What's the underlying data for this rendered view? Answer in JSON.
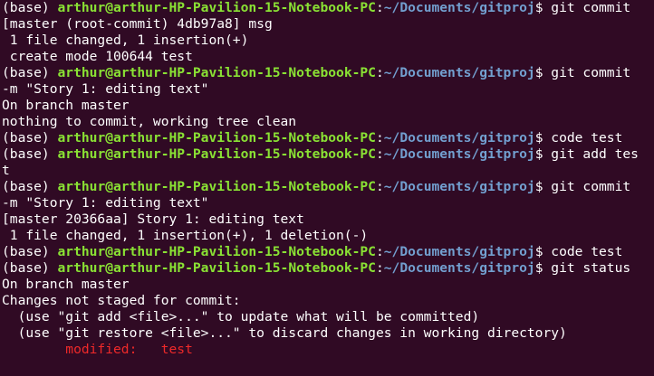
{
  "terminal": {
    "colors": {
      "background": "#300a24",
      "text": "#ffffff",
      "user_host": "#8ae234",
      "path": "#729fcf",
      "modified": "#ef2929"
    },
    "lines": [
      {
        "type": "prompt",
        "env": "(base) ",
        "user": "arthur@arthur-HP-Pavilion-15-Notebook-PC",
        "colon": ":",
        "path": "~/Documents/gitproj",
        "dollar": "$ ",
        "cmd": "git commit"
      },
      {
        "type": "text",
        "text": "[master (root-commit) 4db97a8] msg"
      },
      {
        "type": "text",
        "text": " 1 file changed, 1 insertion(+)"
      },
      {
        "type": "text",
        "text": " create mode 100644 test"
      },
      {
        "type": "prompt",
        "env": "(base) ",
        "user": "arthur@arthur-HP-Pavilion-15-Notebook-PC",
        "colon": ":",
        "path": "~/Documents/gitproj",
        "dollar": "$ ",
        "cmd": "git commit"
      },
      {
        "type": "text",
        "text": "-m \"Story 1: editing text\""
      },
      {
        "type": "text",
        "text": "On branch master"
      },
      {
        "type": "text",
        "text": "nothing to commit, working tree clean"
      },
      {
        "type": "prompt",
        "env": "(base) ",
        "user": "arthur@arthur-HP-Pavilion-15-Notebook-PC",
        "colon": ":",
        "path": "~/Documents/gitproj",
        "dollar": "$ ",
        "cmd": "code test"
      },
      {
        "type": "prompt",
        "env": "(base) ",
        "user": "arthur@arthur-HP-Pavilion-15-Notebook-PC",
        "colon": ":",
        "path": "~/Documents/gitproj",
        "dollar": "$ ",
        "cmd": "git add tes"
      },
      {
        "type": "text",
        "text": "t"
      },
      {
        "type": "prompt",
        "env": "(base) ",
        "user": "arthur@arthur-HP-Pavilion-15-Notebook-PC",
        "colon": ":",
        "path": "~/Documents/gitproj",
        "dollar": "$ ",
        "cmd": "git commit"
      },
      {
        "type": "text",
        "text": "-m \"Story 1: editing text\""
      },
      {
        "type": "text",
        "text": "[master 20366aa] Story 1: editing text"
      },
      {
        "type": "text",
        "text": " 1 file changed, 1 insertion(+), 1 deletion(-)"
      },
      {
        "type": "prompt",
        "env": "(base) ",
        "user": "arthur@arthur-HP-Pavilion-15-Notebook-PC",
        "colon": ":",
        "path": "~/Documents/gitproj",
        "dollar": "$ ",
        "cmd": "code test"
      },
      {
        "type": "prompt",
        "env": "(base) ",
        "user": "arthur@arthur-HP-Pavilion-15-Notebook-PC",
        "colon": ":",
        "path": "~/Documents/gitproj",
        "dollar": "$ ",
        "cmd": "git status"
      },
      {
        "type": "text",
        "text": "On branch master"
      },
      {
        "type": "text",
        "text": "Changes not staged for commit:"
      },
      {
        "type": "text",
        "text": "  (use \"git add <file>...\" to update what will be committed)"
      },
      {
        "type": "text",
        "text": "  (use \"git restore <file>...\" to discard changes in working directory)"
      },
      {
        "type": "text",
        "text": "        modified:   test",
        "color": "red"
      }
    ]
  }
}
